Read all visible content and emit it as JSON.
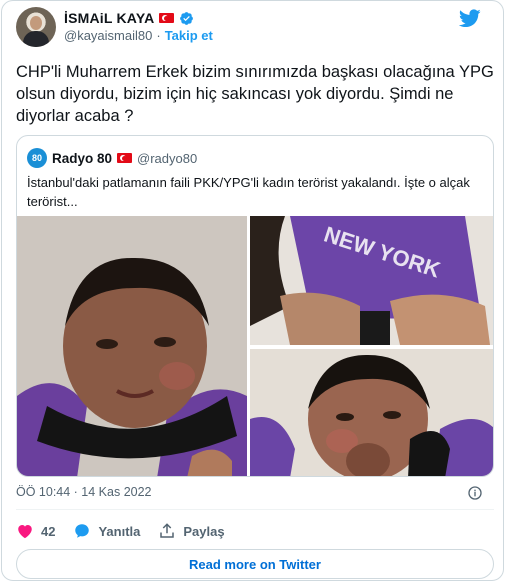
{
  "author": {
    "name": "İSMAiL KAYA",
    "handle": "@kayaismail80",
    "separator": "·",
    "follow_label": "Takip et"
  },
  "tweet": {
    "text": "CHP'li Muharrem Erkek bizim sınırımızda başkası olacağına YPG olsun diyordu, bizim için hiç sakıncası yok diyordu. Şimdi ne diyorlar acaba ?"
  },
  "quoted": {
    "avatar_text": "80",
    "name": "Radyo 80",
    "handle": "@radyo80",
    "text": "İstanbul'daki patlamanın faili PKK/YPG'li kadın terörist yakalandı. İşte o alçak terörist..."
  },
  "meta": {
    "timestamp": "ÖÖ 10:44 · 14 Kas 2022"
  },
  "actions": {
    "like_count": "42",
    "reply_label": "Yanıtla",
    "share_label": "Paylaş"
  },
  "read_more_label": "Read more on Twitter",
  "colors": {
    "accent": "#1d9bf0",
    "like": "#f91880",
    "link": "#006fd6",
    "flag": "#e30a17"
  },
  "icons": [
    "verified-icon",
    "twitter-logo-icon",
    "heart-icon",
    "reply-icon",
    "share-icon",
    "info-icon",
    "flag-icon"
  ]
}
